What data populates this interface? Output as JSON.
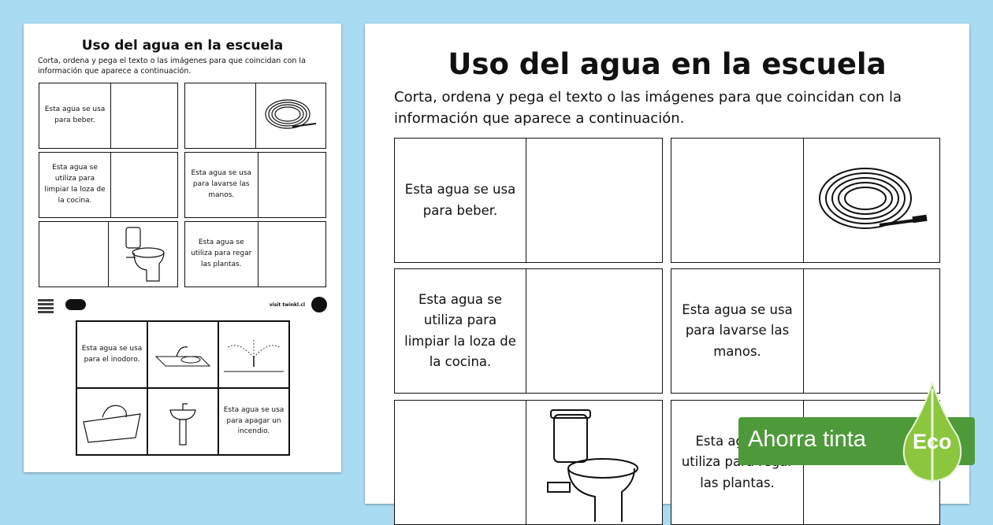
{
  "worksheet": {
    "title": "Uso del agua en la escuela",
    "instructions": "Corta, ordena y pega el texto o las imágenes para que coincidan con la información que aparece a continuación.",
    "instructions_line1": "Corta, ordena y pega el texto o las imágenes para que coincidan con la",
    "instructions_line2": "información que aparece a continuación.",
    "cards": [
      {
        "text": "Esta agua se usa para beber.",
        "image": null
      },
      {
        "text": "",
        "image": "garden-hose"
      },
      {
        "text": "Esta agua se utiliza para limpiar la loza de la cocina.",
        "image": null
      },
      {
        "text": "Esta agua se usa para lavarse las manos.",
        "image": null
      },
      {
        "text": "",
        "image": "toilet"
      },
      {
        "text": "Esta agua se utiliza para regar las plantas.",
        "image": null
      }
    ]
  },
  "small_preview": {
    "cutouts": [
      "Esta agua se usa para el inodoro.",
      "Esta agua se usa para apagar un incendio."
    ],
    "footer_url": "visit twinkl.cl"
  },
  "big_preview": {
    "card_texts_visible": {
      "beber": "Esta agua se usa para beber.",
      "loza": "Esta agua se utiliza para limpiar la loza de la cocina.",
      "manos": "Esta agua se usa para lavarse las manos.",
      "regar_partial": "Esta a se uti para regar las plantas"
    }
  },
  "eco_badge": {
    "label": "Ahorra tinta",
    "eco": "Eco",
    "color": "#4e9a3a"
  }
}
